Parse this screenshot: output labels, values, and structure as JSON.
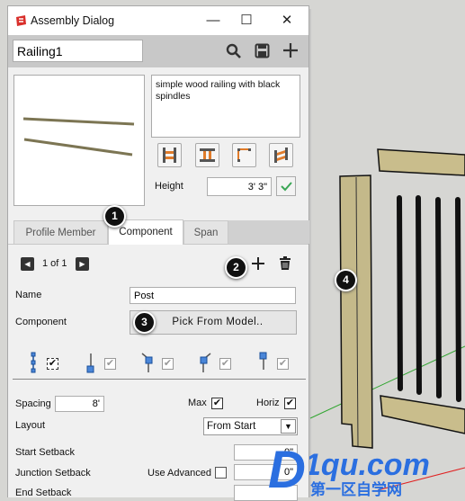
{
  "window": {
    "title": "Assembly Dialog",
    "minimize": "—",
    "maximize": "☐",
    "close": "✕",
    "app_icon": "sketchup-logo-icon"
  },
  "toolbar": {
    "assembly_name": "Railing1",
    "icons": [
      "search-icon",
      "save-icon",
      "plus-icon"
    ]
  },
  "description": "simple wood railing with black spindles",
  "height": {
    "label": "Height",
    "value": "3' 3\""
  },
  "tabs": [
    {
      "label": "Profile Member",
      "active": false
    },
    {
      "label": "Component",
      "active": true
    },
    {
      "label": "Span",
      "active": false
    }
  ],
  "component": {
    "pager": "1 of 1",
    "name_label": "Name",
    "name_value": "Post",
    "component_label": "Component",
    "pick_button": "Pick From Model..",
    "placement_checks": [
      true,
      true,
      true,
      true,
      true
    ],
    "spacing_label": "Spacing",
    "spacing_value": "8'",
    "max_label": "Max",
    "max_checked": true,
    "horiz_label": "Horiz",
    "horiz_checked": true,
    "layout_label": "Layout",
    "layout_value": "From Start",
    "start_setback_label": "Start Setback",
    "start_setback_value": "0\"",
    "junction_setback_label": "Junction Setback",
    "use_advanced_label": "Use Advanced",
    "use_advanced_checked": false,
    "junction_setback_value": "0\"",
    "end_setback_label": "End Setback",
    "end_setback_value": ""
  },
  "callouts": [
    "1",
    "2",
    "3",
    "4"
  ],
  "watermark": {
    "text": "D1qu.com",
    "subtext": "第一区自学网"
  },
  "colors": {
    "accent_orange": "#e07b2a",
    "check_green": "#3aa655",
    "wood": "#c4b98a",
    "spindle": "#1a1a1a"
  }
}
